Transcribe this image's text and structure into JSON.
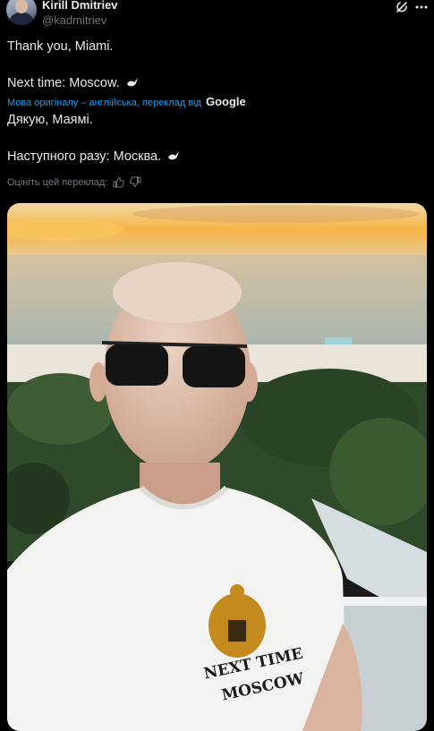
{
  "author": {
    "name": "Kirill Dmitriev",
    "handle": "@kadmitriev"
  },
  "header_icons": [
    "grok-icon",
    "more-options-icon"
  ],
  "tweet": {
    "line1": "Thank you, Miami.",
    "line2": "Next time: Moscow.",
    "emoji": "dove-icon"
  },
  "translation": {
    "attribution": "Мова оригіналу – англійська, переклад від",
    "provider": "Google",
    "line1": "Дякую, Маямі.",
    "line2": "Наступного разу: Москва."
  },
  "rate": {
    "label": "Оцініть цей переклад:",
    "icons": [
      "thumbs-up-icon",
      "thumbs-down-icon"
    ]
  },
  "photo": {
    "shirt_text_line1": "NEXT TIME",
    "shirt_text_line2": "MOSCOW",
    "colors": {
      "sky": "#f4a941",
      "sea": "#b8ab8f",
      "palm": "#2f4a2a",
      "shirt": "#f3f3f1"
    }
  }
}
